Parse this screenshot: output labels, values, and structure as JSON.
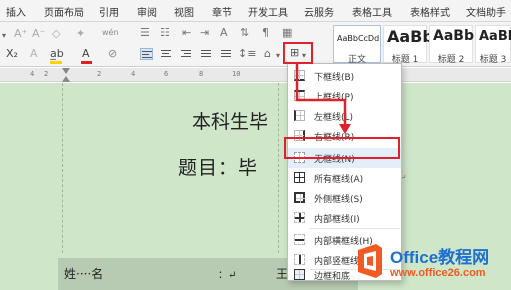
{
  "menu": {
    "tabs": [
      "插入",
      "页面布局",
      "引用",
      "审阅",
      "视图",
      "章节",
      "开发工具",
      "云服务",
      "表格工具",
      "表格样式",
      "文档助手"
    ]
  },
  "ribbon": {
    "row1_glyphs": [
      "A⁺",
      "A⁻",
      "◇",
      "✦"
    ],
    "row2_glyphs": [
      "X₂",
      "A",
      "a̲b",
      "A",
      "⊘"
    ],
    "pinyin_icon": "wén",
    "text_color_hint": "A",
    "border_button_glyph": "⊞"
  },
  "styles": [
    {
      "sample": "AaBbCcDd",
      "name": "正文"
    },
    {
      "sample": "AaBb",
      "name": "标题 1"
    },
    {
      "sample": "AaBb(",
      "name": "标题 2"
    },
    {
      "sample": "AaBb",
      "name": "标题 3"
    }
  ],
  "ruler": {
    "numbers": [
      "4",
      "2",
      "2",
      "4",
      "6",
      "8",
      "10"
    ]
  },
  "document": {
    "line1": "本科生毕",
    "line2": "题目：毕",
    "name_label": "姓····名",
    "name_colon": "：↵",
    "name_trailing": "王"
  },
  "border_menu": {
    "items": [
      {
        "label": "下框线(B)",
        "icon": "bottom-border-icon"
      },
      {
        "label": "上框线(P)",
        "icon": "top-border-icon"
      },
      {
        "label": "左框线(L)",
        "icon": "left-border-icon"
      },
      {
        "label": "右框线(R)",
        "icon": "right-border-icon"
      },
      {
        "label": "无框线(N)",
        "icon": "no-border-icon"
      },
      {
        "label": "所有框线(A)",
        "icon": "all-borders-icon"
      },
      {
        "label": "外侧框线(S)",
        "icon": "outside-borders-icon"
      },
      {
        "label": "内部框线(I)",
        "icon": "inside-borders-icon"
      },
      {
        "label": "内部横框线(H)",
        "icon": "inside-horizontal-border-icon"
      },
      {
        "label": "内部竖框线",
        "icon": "inside-vertical-border-icon"
      },
      {
        "label": "边框和底",
        "icon": "borders-and-shading-icon"
      }
    ]
  },
  "watermark": {
    "brand": "Office教程网",
    "url": "www.office26.com"
  },
  "colors": {
    "highlight_red": "#e0202a",
    "document_bg": "#cfe6c9",
    "brand_orange": "#f15a22",
    "brand_blue": "#1e6fd0"
  }
}
